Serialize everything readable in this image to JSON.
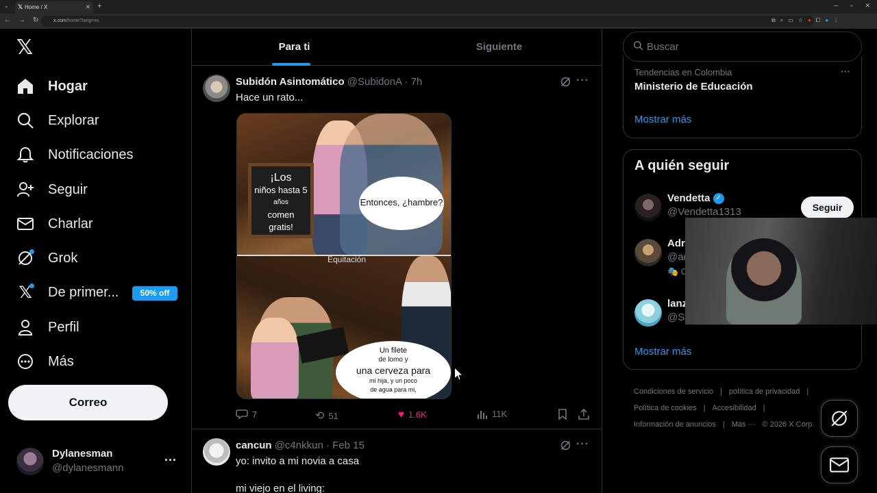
{
  "browser": {
    "tab_title": "Home / X",
    "url_host": "x.com",
    "url_path": "/home?lang=es",
    "new_tab": "+",
    "tab_close": "✕"
  },
  "nav": {
    "items": [
      {
        "label": "Hogar",
        "icon": "home-icon"
      },
      {
        "label": "Explorar",
        "icon": "search-icon"
      },
      {
        "label": "Notificaciones",
        "icon": "bell-icon"
      },
      {
        "label": "Seguir",
        "icon": "follow-icon"
      },
      {
        "label": "Charlar",
        "icon": "mail-icon"
      },
      {
        "label": "Grok",
        "icon": "grok-icon"
      },
      {
        "label": "De primer...",
        "icon": "x-premium-icon"
      },
      {
        "label": "Perfil",
        "icon": "person-icon"
      },
      {
        "label": "Más",
        "icon": "more-circle-icon"
      }
    ],
    "promo": "50% off",
    "post_button": "Correo"
  },
  "account": {
    "name": "Dylanesman",
    "handle": "@dylanesmann"
  },
  "feed": {
    "tabs": [
      {
        "label": "Para ti",
        "active": true
      },
      {
        "label": "Siguiente",
        "active": false
      }
    ],
    "tweets": [
      {
        "name": "Subidón Asintomático",
        "handle": "@SubidonA",
        "time": "· 7h",
        "text": "Hace un rato...",
        "image": {
          "board_line1": "¡Los",
          "board_line2": "niños hasta 5",
          "board_line3": "años",
          "board_line4": "comen gratis!",
          "bubble_top": "Entonces, ¿hambre?",
          "watermark": "Equitación",
          "bubble_line1": "Un filete",
          "bubble_line2": "de lomo y",
          "bubble_line3": "una cerveza para",
          "bubble_line4": "mi hija, y un poco",
          "bubble_line5": "de agua para mi,"
        },
        "replies": "7",
        "reposts": "51",
        "likes": "1.6K",
        "views": "11K"
      },
      {
        "name": "cancun",
        "handle": "@c4nkkun",
        "time": "· Feb 15",
        "text_line1": "yo: invito a mi novia a casa",
        "text_line2": "mi viejo en el living:"
      }
    ]
  },
  "sidebar": {
    "search_placeholder": "Buscar",
    "trend": {
      "category": "Tendencias en Colombia",
      "name": "Ministerio de Educación",
      "show_more": "Mostrar más"
    },
    "who_to_follow": {
      "title": "A quién seguir",
      "suggestions": [
        {
          "name": "Vendetta",
          "handle": "@Vendetta1313",
          "verified": true,
          "button": "Seguir"
        },
        {
          "name": "Adr",
          "handle": "@ad",
          "extra": "🎭 C"
        },
        {
          "name": "lanz",
          "handle": "@St"
        }
      ],
      "show_more": "Mostrar más"
    },
    "footer": [
      "Condiciones de servicio",
      "|",
      "política de privacidad",
      "|",
      "Política de cookies",
      "|",
      "Accesibilidad",
      "|",
      "Información de anuncios",
      "|",
      "Más ···",
      "© 2026 X Corp."
    ]
  },
  "colors": {
    "accent": "#1d9bf0",
    "like": "#f91880",
    "background": "#000000",
    "border": "#2f3336",
    "muted": "#71767b"
  }
}
